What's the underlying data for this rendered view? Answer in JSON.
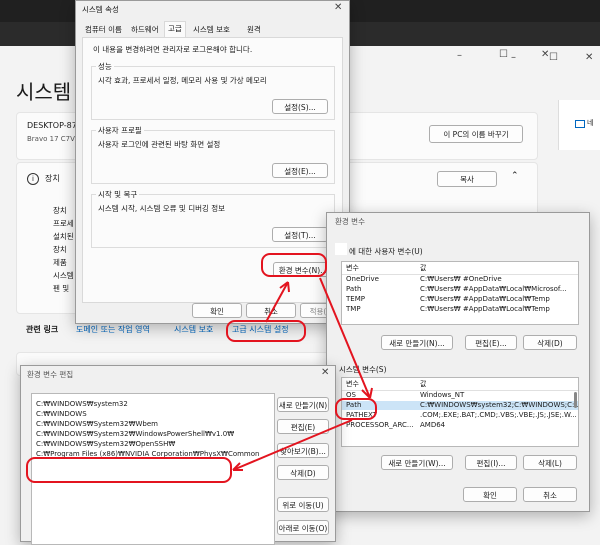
{
  "system_page": {
    "title": "시스템",
    "device_name": "DESKTOP-87",
    "device_model": "Bravo 17 C7V",
    "rename_button": "이 PC의 이름 바꾸기",
    "specs_header": "장치",
    "copy_button": "복사",
    "spec_labels": [
      "장치",
      "프로세",
      "설치된",
      "장치",
      "제품",
      "시스템",
      "펜 및"
    ],
    "related_links_label": "관련 링크",
    "links": [
      "도메인 또는 작업 영역",
      "시스템 보호",
      "고급 시스템 설정"
    ],
    "top_right_icon_text": "네"
  },
  "sysprops": {
    "title": "시스템 속성",
    "tabs": [
      "컴퓨터 이름",
      "하드웨어",
      "고급",
      "시스템 보호",
      "원격"
    ],
    "active_tab_index": 2,
    "admin_note": "이 내용을 변경하려면 관리자로 로그온해야 합니다.",
    "groups": [
      {
        "label": "성능",
        "text": "시각 효과, 프로세서 일정, 메모리 사용 및 가상 메모리",
        "button": "설정(S)..."
      },
      {
        "label": "사용자 프로필",
        "text": "사용자 로그인에 관련된 바탕 화면 설정",
        "button": "설정(E)..."
      },
      {
        "label": "시작 및 복구",
        "text": "시스템 시작, 시스템 오류 및 디버깅 정보",
        "button": "설정(T)..."
      }
    ],
    "env_button": "환경 변수(N)...",
    "ok": "확인",
    "cancel": "취소",
    "apply": "적용(A)"
  },
  "envvars": {
    "title": "환경 변수",
    "user_group_label": "에 대한 사용자 변수(U)",
    "columns": [
      "변수",
      "값"
    ],
    "user_vars": [
      {
        "name": "OneDrive",
        "value": "C:₩Users₩            #OneDrive"
      },
      {
        "name": "Path",
        "value": "C:₩Users₩            #AppData₩Local₩Microsof..."
      },
      {
        "name": "TEMP",
        "value": "C:₩Users₩            #AppData₩Local₩Temp"
      },
      {
        "name": "TMP",
        "value": "C:₩Users₩            #AppData₩Local₩Temp"
      }
    ],
    "user_buttons": [
      "새로 만들기(N)...",
      "편집(E)...",
      "삭제(D)"
    ],
    "system_group_label": "시스템 변수(S)",
    "system_vars": [
      {
        "name": "OS",
        "value": "Windows_NT"
      },
      {
        "name": "Path",
        "value": "C:₩WINDOWS₩system32;C:₩WINDOWS;C:..."
      },
      {
        "name": "PATHEXT",
        "value": ".COM;.EXE;.BAT;.CMD;.VBS;.VBE;.JS;.JSE;.W..."
      },
      {
        "name": "PROCESSOR_ARC...",
        "value": "AMD64"
      }
    ],
    "selected_system_index": 1,
    "system_buttons": [
      "새로 만들기(W)...",
      "편집(I)...",
      "삭제(L)"
    ],
    "ok": "확인",
    "cancel": "취소"
  },
  "editenv": {
    "title": "환경 변수 편집",
    "entries": [
      "C:₩WINDOWS₩system32",
      "C:₩WINDOWS",
      "C:₩WINDOWS₩System32₩Wbem",
      "C:₩WINDOWS₩System32₩WindowsPowerShell₩v1.0₩",
      "C:₩WINDOWS₩System32₩OpenSSH₩",
      "C:₩Program Files (x86)₩NVIDIA Corporation₩PhysX₩Common"
    ],
    "buttons": [
      "새로 만들기(N)",
      "편집(E)",
      "찾아보기(B)...",
      "삭제(D)",
      "위로 이동(U)",
      "아래로 이동(O)"
    ]
  },
  "colors": {
    "highlight_red": "#e3141f",
    "link_blue": "#0067c0",
    "selection": "#cce4f7"
  }
}
